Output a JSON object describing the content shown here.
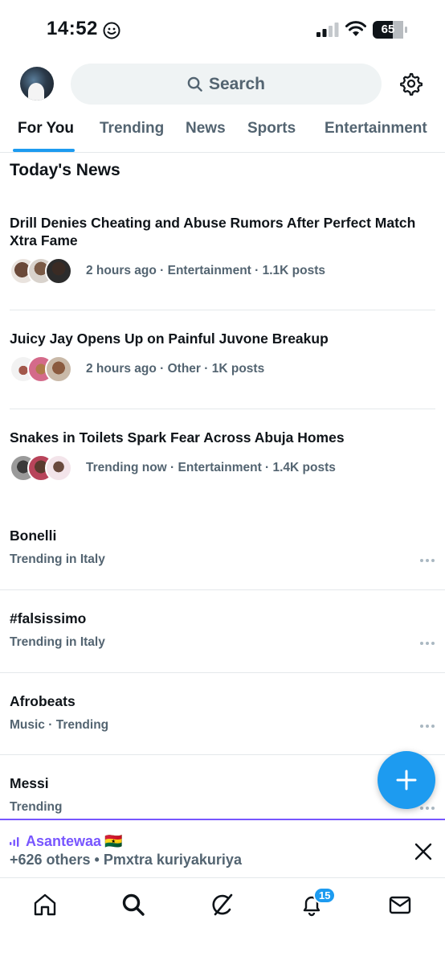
{
  "status_bar": {
    "time": "14:52",
    "battery": "65"
  },
  "header": {
    "search_placeholder": "Search"
  },
  "tabs": [
    {
      "label": "For You",
      "active": true
    },
    {
      "label": "Trending",
      "active": false
    },
    {
      "label": "News",
      "active": false
    },
    {
      "label": "Sports",
      "active": false
    },
    {
      "label": "Entertainment",
      "active": false
    }
  ],
  "section_title": "Today's News",
  "news": [
    {
      "headline": "Drill Denies Cheating and Abuse Rumors After Perfect Match Xtra Fame",
      "meta": "2 hours ago · Entertainment · 1.1K posts"
    },
    {
      "headline": "Juicy Jay Opens Up on Painful Juvone Breakup",
      "meta": "2 hours ago · Other · 1K posts"
    },
    {
      "headline": "Snakes in Toilets Spark Fear Across Abuja Homes",
      "meta": "Trending now · Entertainment · 1.4K posts"
    }
  ],
  "trends": [
    {
      "title": "Bonelli",
      "subtitle": "Trending in Italy"
    },
    {
      "title": "#falsissimo",
      "subtitle": "Trending in Italy"
    },
    {
      "title": "Afrobeats",
      "subtitle": "Music · Trending"
    },
    {
      "title": "Messi",
      "subtitle": "Trending"
    }
  ],
  "spaces": {
    "host": "Asantewaa",
    "flag": "🇬🇭",
    "detail": "+626 others • Pmxtra kuriyakuriya"
  },
  "bottom_nav": {
    "notifications_badge": "15"
  },
  "colors": {
    "accent": "#1d9bf0",
    "spaces": "#7856ff",
    "secondary_text": "#536471"
  }
}
